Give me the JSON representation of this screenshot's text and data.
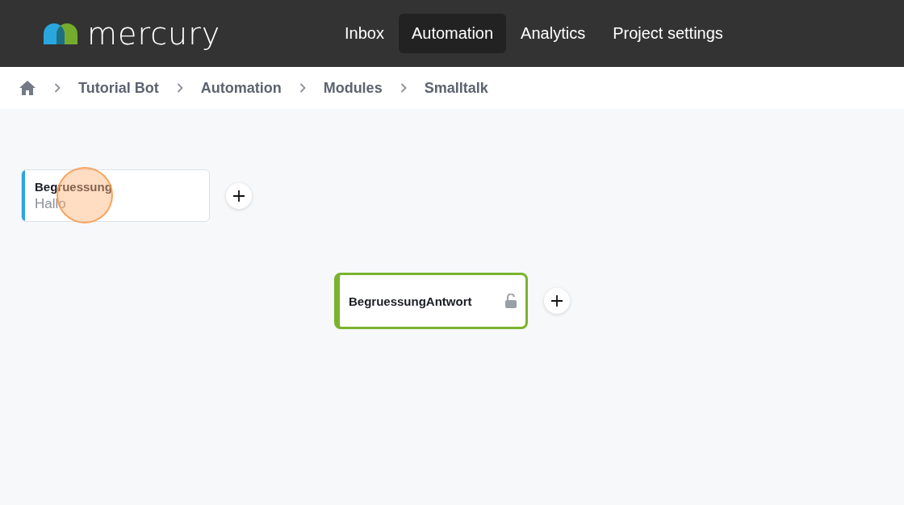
{
  "app": {
    "logo_text": "mercury"
  },
  "nav": [
    {
      "label": "Inbox",
      "selected": false
    },
    {
      "label": "Automation",
      "selected": true
    },
    {
      "label": "Analytics",
      "selected": false
    },
    {
      "label": "Project settings",
      "selected": false
    }
  ],
  "breadcrumb": [
    "Tutorial Bot",
    "Automation",
    "Modules",
    "Smalltalk"
  ],
  "nodes": [
    {
      "kind": "trigger",
      "title": "Begruessung",
      "subtitle": "Hallo",
      "color": "#2aa6de"
    },
    {
      "kind": "response",
      "title": "BegruessungAntwort",
      "color": "#7ab32e",
      "locked": false
    }
  ]
}
